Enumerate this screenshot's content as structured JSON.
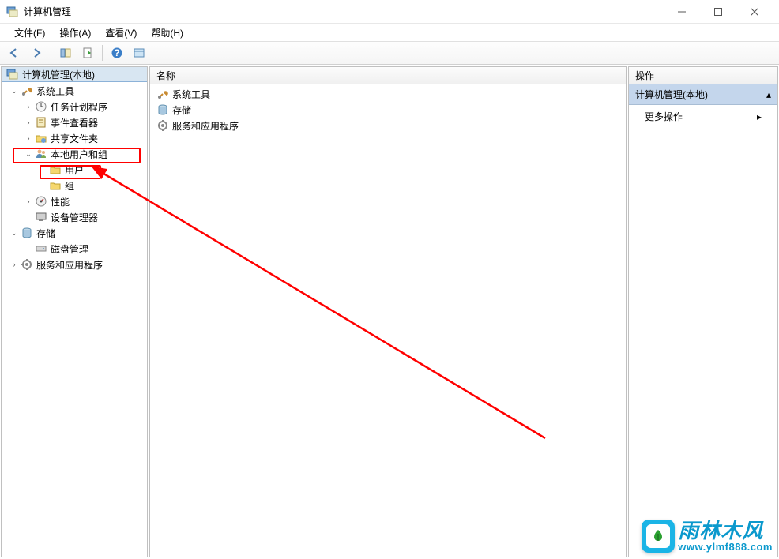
{
  "window": {
    "title": "计算机管理"
  },
  "menu": {
    "file": "文件(F)",
    "action": "操作(A)",
    "view": "查看(V)",
    "help": "帮助(H)"
  },
  "tree": {
    "root": "计算机管理(本地)",
    "system_tools": "系统工具",
    "task_scheduler": "任务计划程序",
    "event_viewer": "事件查看器",
    "shared_folders": "共享文件夹",
    "local_users_groups": "本地用户和组",
    "users": "用户",
    "groups": "组",
    "performance": "性能",
    "device_manager": "设备管理器",
    "storage": "存储",
    "disk_management": "磁盘管理",
    "services_apps": "服务和应用程序"
  },
  "list": {
    "header_name": "名称",
    "items": [
      {
        "label": "系统工具"
      },
      {
        "label": "存储"
      },
      {
        "label": "服务和应用程序"
      }
    ]
  },
  "actions": {
    "header": "操作",
    "section": "计算机管理(本地)",
    "more": "更多操作"
  },
  "watermark": {
    "top": "雨林木风",
    "bottom": "www.ylmf888.com"
  }
}
